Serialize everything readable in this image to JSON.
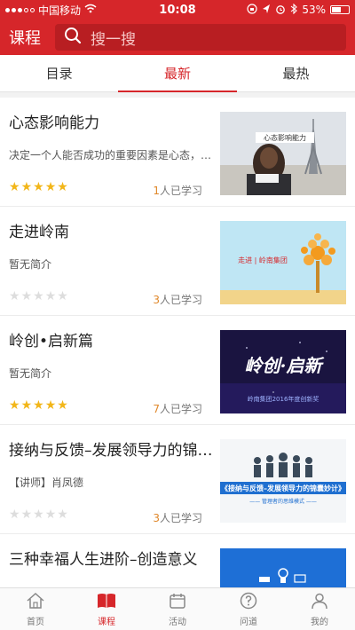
{
  "status_bar": {
    "carrier": "中国移动",
    "time": "10:08",
    "battery": "53%"
  },
  "header": {
    "title": "课程",
    "search_placeholder": "搜一搜"
  },
  "tabs": [
    {
      "label": "目录",
      "active": false
    },
    {
      "label": "最新",
      "active": true
    },
    {
      "label": "最热",
      "active": false
    }
  ],
  "courses": [
    {
      "title": "心态影响能力",
      "desc": "决定一个人能否成功的重要因素是心态，心…",
      "rating": 5,
      "learned_count": "1",
      "learned_suffix": "人已学习",
      "thumb_caption": "心态影响能力"
    },
    {
      "title": "走进岭南",
      "desc": "暂无简介",
      "rating": 0,
      "learned_count": "3",
      "learned_suffix": "人已学习",
      "thumb_caption": "走进 | 岭南集团"
    },
    {
      "title": "岭创•启新篇",
      "desc": "暂无简介",
      "rating": 5,
      "learned_count": "7",
      "learned_suffix": "人已学习",
      "thumb_caption": "岭创·启新",
      "thumb_sub": "岭南集团2016年度创新奖"
    },
    {
      "title": "接纳与反馈–发展领导力的锦…",
      "desc": "【讲师】肖凤德",
      "rating": 0,
      "learned_count": "3",
      "learned_suffix": "人已学习",
      "thumb_caption": "《接纳与反馈–发展领导力的锦囊妙计》",
      "thumb_sub": "—— 管理者的思维模式 ——"
    },
    {
      "title": "三种幸福人生进阶–创造意义",
      "desc": "",
      "rating": 0,
      "learned_count": "",
      "learned_suffix": "",
      "thumb_caption": ""
    }
  ],
  "tabbar": [
    {
      "label": "首页",
      "icon": "home-icon",
      "active": false
    },
    {
      "label": "课程",
      "icon": "book-icon",
      "active": true
    },
    {
      "label": "活动",
      "icon": "calendar-icon",
      "active": false
    },
    {
      "label": "问道",
      "icon": "question-icon",
      "active": false
    },
    {
      "label": "我的",
      "icon": "person-icon",
      "active": false
    }
  ],
  "colors": {
    "brand": "#d6262a",
    "star": "#f2b619",
    "count": "#e0882b"
  }
}
